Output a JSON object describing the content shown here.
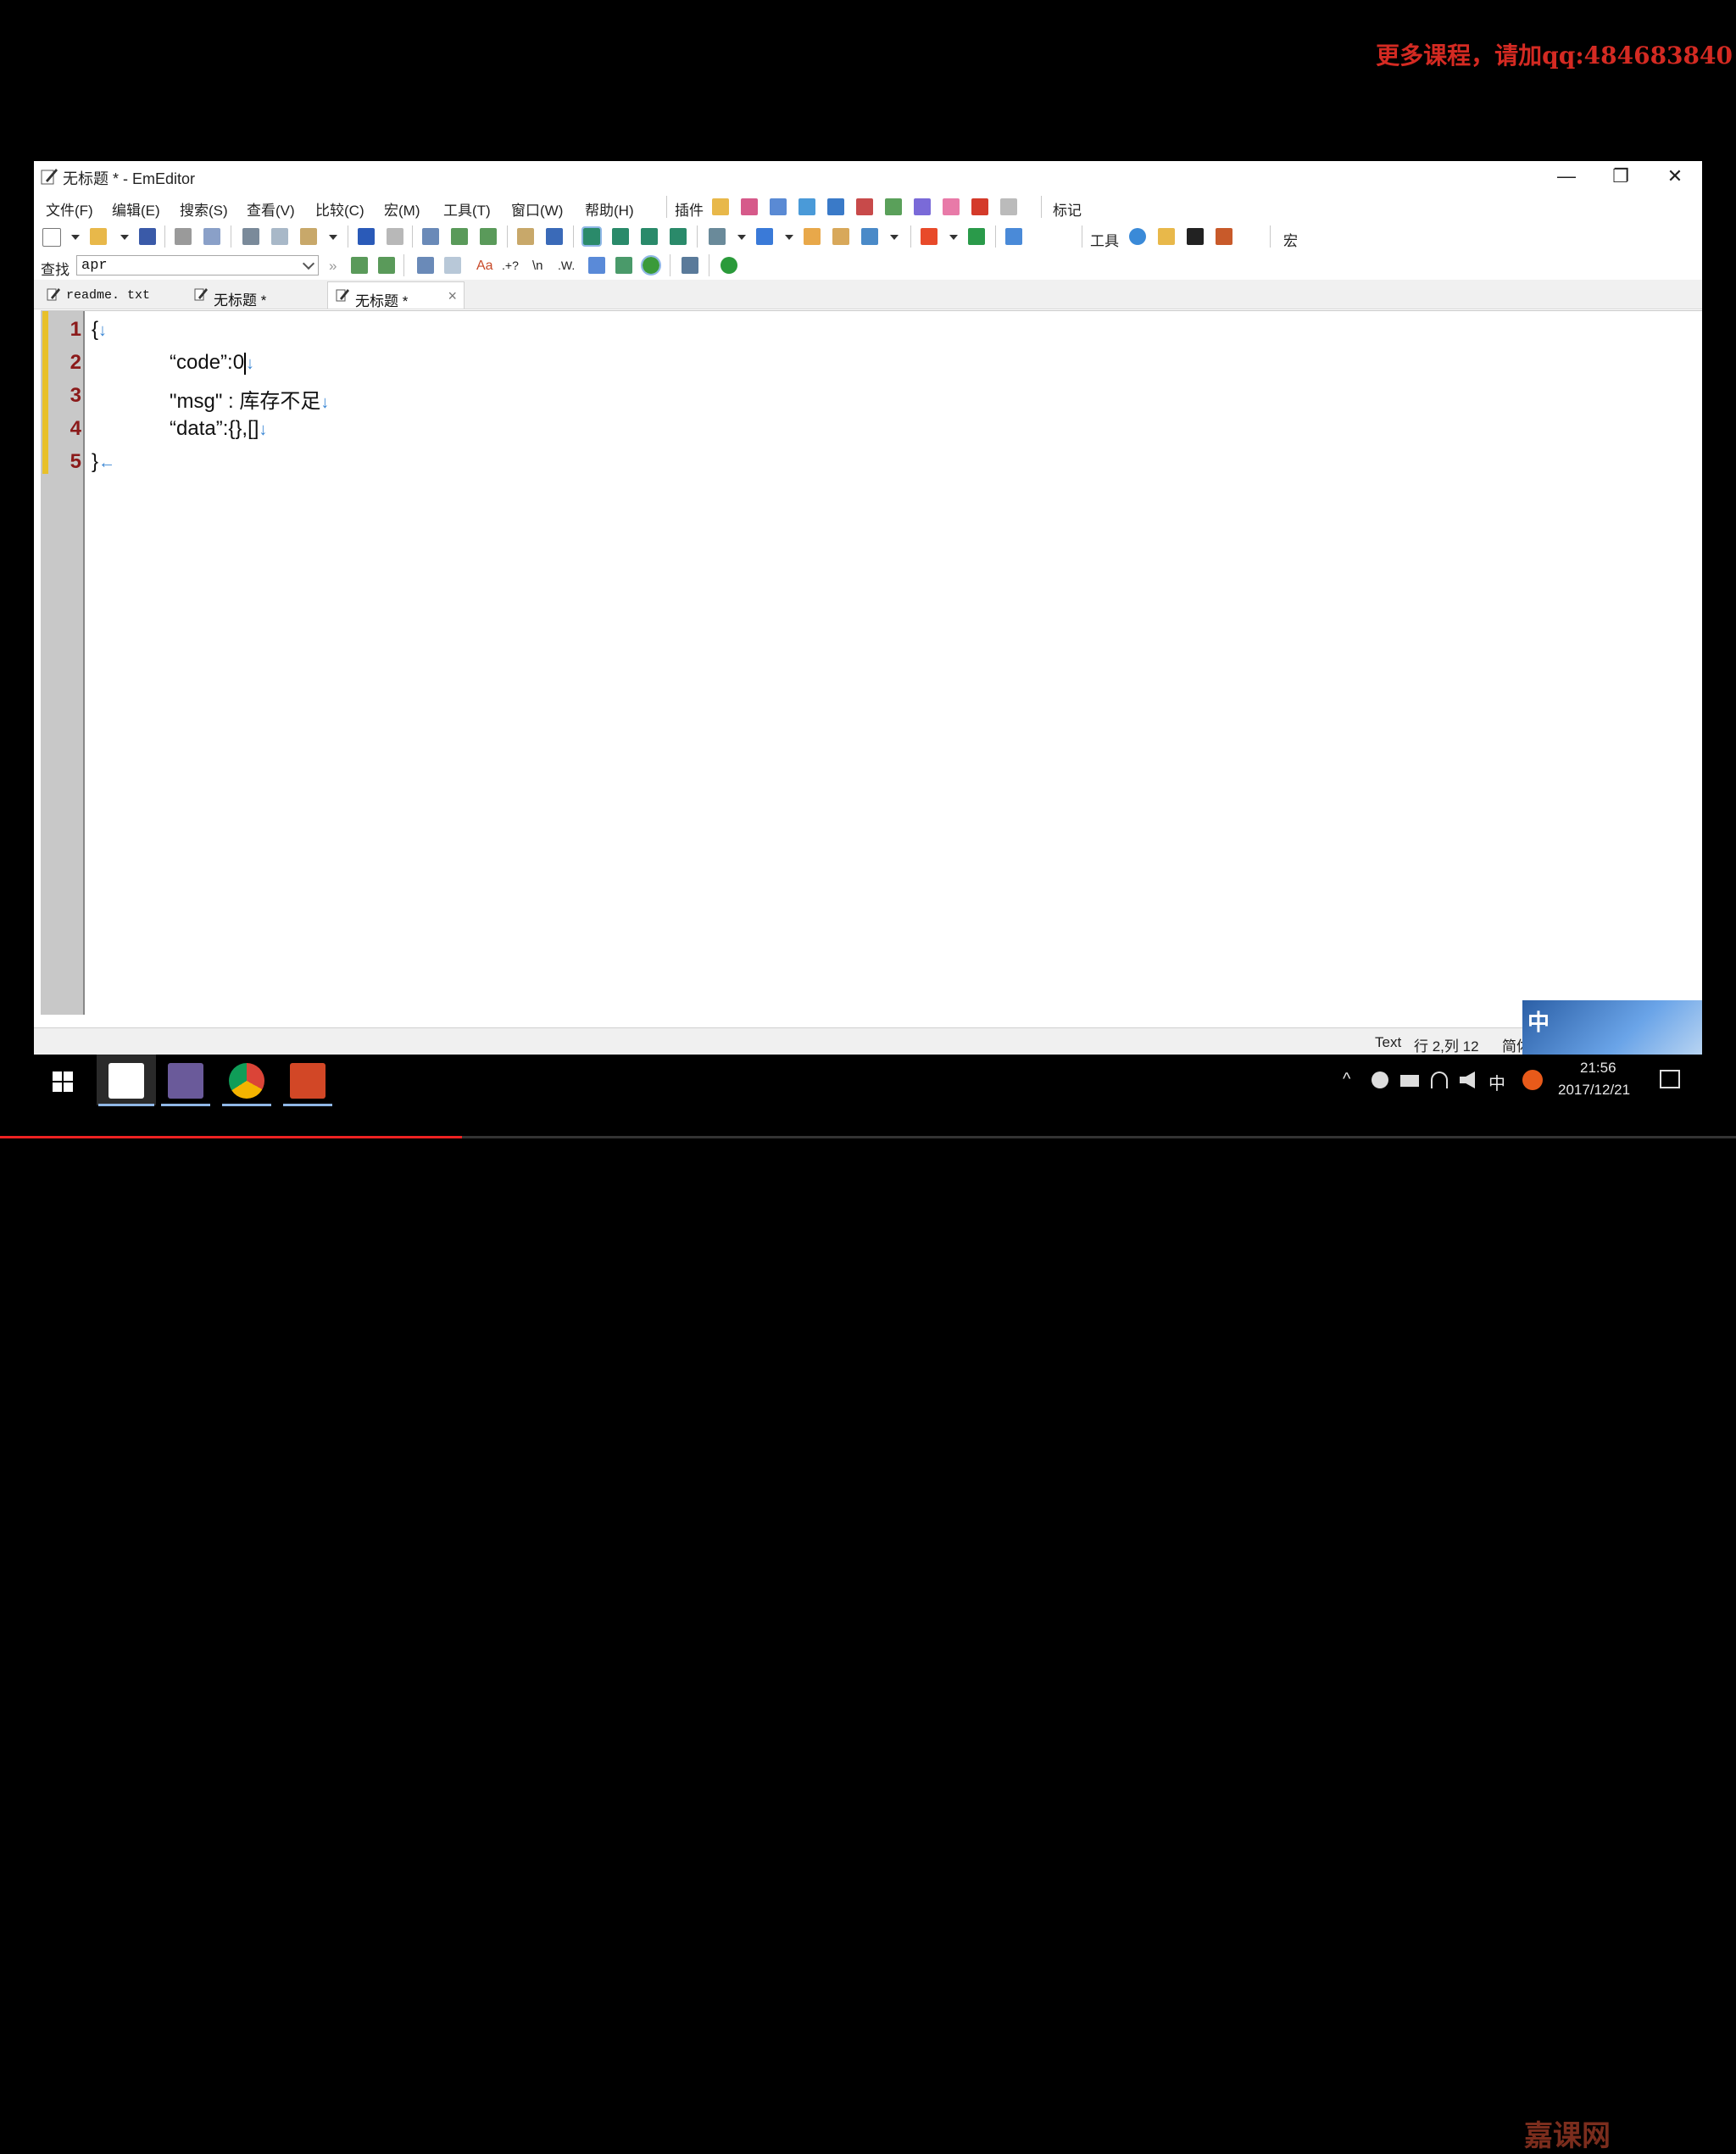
{
  "window": {
    "title": "无标题 * - EmEditor",
    "controls": [
      "—",
      "❐",
      "✕"
    ]
  },
  "menu": [
    {
      "label": "文件(F)"
    },
    {
      "label": "编辑(E)"
    },
    {
      "label": "搜索(S)"
    },
    {
      "label": "查看(V)"
    },
    {
      "label": "比较(C)"
    },
    {
      "label": "宏(M)"
    },
    {
      "label": "工具(T)"
    },
    {
      "label": "窗口(W)"
    },
    {
      "label": "帮助(H)"
    }
  ],
  "toolbar_groups": {
    "plugins_label": "插件",
    "marker_label": "标记",
    "tools_label": "工具",
    "macro_label": "宏"
  },
  "promo": "更多课程，请加qq:484683840",
  "find": {
    "label": "查找",
    "value": "apr",
    "options": [
      "»",
      "Aa",
      ".+?",
      "\\n",
      ".W."
    ]
  },
  "tabs": [
    {
      "label": "readme. txt"
    },
    {
      "label": "无标题 *"
    },
    {
      "label": "无标题 *",
      "close": "×"
    }
  ],
  "editor": {
    "lines": [
      {
        "number": "1",
        "text": "{",
        "eol": "↓"
      },
      {
        "number": "2",
        "text": "“code”:0",
        "eol": "↓"
      },
      {
        "number": "3",
        "text": "\"msg\" : 库存不足",
        "eol": "↓"
      },
      {
        "number": "4",
        "text": "“data”:{},[]",
        "eol": "↓"
      },
      {
        "number": "5",
        "text": "}",
        "eol": "←"
      }
    ]
  },
  "status": {
    "mode": "Text",
    "position": "行 2,列 12",
    "encoding": "简体"
  },
  "tray": {
    "ime": "中",
    "time": "21:56",
    "date": "2017/12/21",
    "caret": "^"
  },
  "overlay": {
    "ime_badge": "中",
    "watermark": "嘉课网"
  },
  "video_progress": 0.266,
  "colors": {
    "promo": "#d42a22",
    "line_numbers": "#8b1a1a",
    "mark_bar": "#e8c02a",
    "eol_marks": "#3a86d4"
  }
}
